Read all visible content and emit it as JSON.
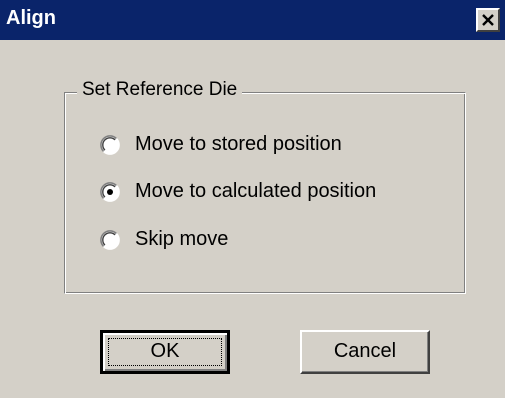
{
  "window": {
    "title": "Align",
    "close_icon": "close-icon"
  },
  "group": {
    "legend": "Set Reference Die",
    "options": [
      {
        "label": "Move to stored position",
        "selected": false
      },
      {
        "label": "Move to calculated position",
        "selected": true
      },
      {
        "label": "Skip move",
        "selected": false
      }
    ]
  },
  "buttons": {
    "ok_label": "OK",
    "cancel_label": "Cancel"
  },
  "colors": {
    "titlebar": "#0a246a",
    "face": "#d4d0c8"
  }
}
